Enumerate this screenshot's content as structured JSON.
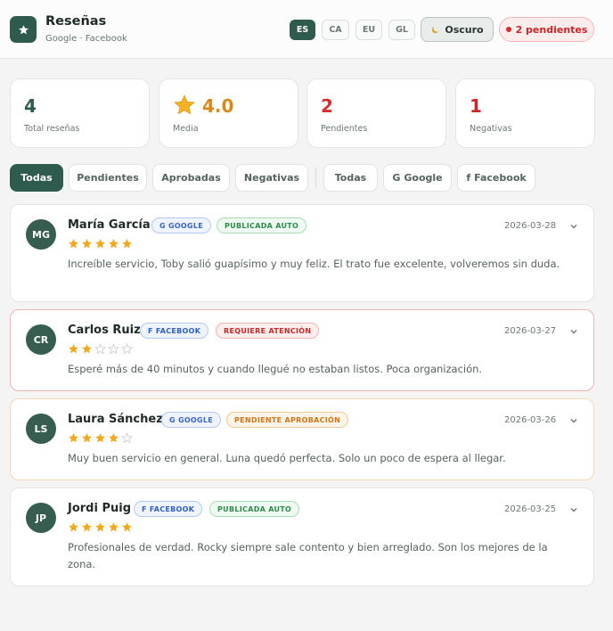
{
  "header": {
    "title": "Reseñas",
    "subtitle": "Google · Facebook",
    "logo_icon": "star-icon",
    "languages": [
      "ES",
      "CA",
      "EU",
      "GL"
    ],
    "active_language": "ES",
    "theme_button": {
      "icon": "moon-icon",
      "label": "Oscuro"
    },
    "pending_pill": {
      "label": "2 pendientes",
      "color": "#c62828"
    }
  },
  "stats": [
    {
      "value": "4",
      "label": "Total reseñas",
      "color": "#2f5b4e"
    },
    {
      "value": "4.0",
      "label": "Media",
      "color": "#d9891a",
      "icon": "star-emoji-icon"
    },
    {
      "value": "2",
      "label": "Pendientes",
      "color": "#d32f2f"
    },
    {
      "value": "1",
      "label": "Negativas",
      "color": "#c62828"
    }
  ],
  "filters": {
    "status": [
      "Todas",
      "Pendientes",
      "Aprobadas",
      "Negativas"
    ],
    "status_active": "Todas",
    "source": [
      {
        "label": "Todas",
        "icon": ""
      },
      {
        "label": "Google",
        "icon": "G"
      },
      {
        "label": "Facebook",
        "icon": "f"
      }
    ]
  },
  "reviews": [
    {
      "initials": "MG",
      "name": "María García",
      "source_badge": "G GOOGLE",
      "source": "google",
      "status_badge": "PUBLICADA AUTO",
      "status": "green",
      "date": "2026-03-28",
      "rating": 5,
      "text": "Increíble servicio, Toby salió guapísimo y muy feliz. El trato fue excelente, volveremos sin duda."
    },
    {
      "initials": "CR",
      "name": "Carlos Ruiz",
      "source_badge": "F FACEBOOK",
      "source": "facebook",
      "status_badge": "REQUIERE ATENCIÓN",
      "status": "red",
      "date": "2026-03-27",
      "rating": 2,
      "text": "Esperé más de 40 minutos y cuando llegué no estaban listos. Poca organización."
    },
    {
      "initials": "LS",
      "name": "Laura Sánchez",
      "source_badge": "G GOOGLE",
      "source": "google",
      "status_badge": "PENDIENTE APROBACIÓN",
      "status": "orange",
      "date": "2026-03-26",
      "rating": 4,
      "text": "Muy buen servicio en general. Luna quedó perfecta. Solo un poco de espera al llegar."
    },
    {
      "initials": "JP",
      "name": "Jordi Puig",
      "source_badge": "F FACEBOOK",
      "source": "facebook",
      "status_badge": "PUBLICADA AUTO",
      "status": "green",
      "date": "2026-03-25",
      "rating": 5,
      "text": "Profesionales de verdad. Rocky siempre sale contento y bien arreglado. Son los mejores de la zona."
    }
  ],
  "colors": {
    "accent": "#2f5b4e",
    "star_filled": "#f2a81d",
    "star_empty": "#c9cfcc"
  }
}
